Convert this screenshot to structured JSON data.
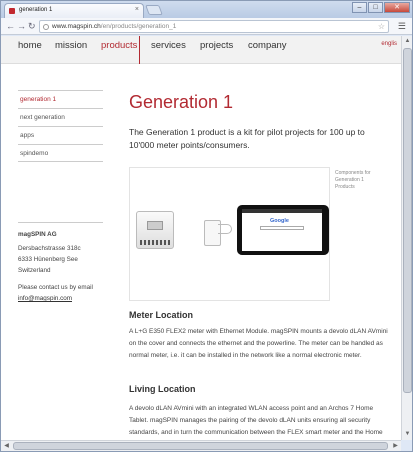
{
  "browser": {
    "tab_title": "generation 1",
    "tab_close": "×",
    "url_domain": "www.magspin.ch",
    "url_path": "/en/products/generation_1",
    "back": "←",
    "forward": "→",
    "reload": "↻",
    "star": "☆",
    "menu": "🔧",
    "minimize": "–",
    "maximize": "□",
    "close": "✕"
  },
  "nav": {
    "items": [
      "home",
      "mission",
      "products",
      "services",
      "projects",
      "company"
    ],
    "active": "products",
    "lang": "englis"
  },
  "sidebar": {
    "items": [
      "generation 1",
      "next generation",
      "apps",
      "spindemo"
    ],
    "active": "generation 1"
  },
  "company": {
    "name": "magSPIN AG",
    "street": "Dersbachstrasse 318c",
    "city": "6333 Hünenberg See",
    "country": "Switzerland",
    "contact_text": "Please contact us by email",
    "email": "info@magspin.com"
  },
  "main": {
    "title": "Generation 1",
    "intro": "The Generation 1 product is a kit for pilot projects for 100 up to 10'000 meter points/consumers.",
    "caption": "Components for Generation 1 Products",
    "tablet_logo": "Google",
    "sections": [
      {
        "heading": "Meter Location",
        "text": "A L+G E350 FLEX2 meter with Ethernet Module. magSPIN mounts a devolo dLAN AVmini on the cover and connects the ethernet and the powerline. The meter can be handled as normal meter, i.e. it can be installed in the network like a normal electronic meter."
      },
      {
        "heading": "Living Location",
        "text": "A devolo dLAN AVmini with an integrated WLAN access point and an Archos 7 Home Tablet. magSPIN manages the pairing of the devolo dLAN units ensuring all security standards, and in turn the communication between the FLEX smart meter and the Home"
      }
    ]
  },
  "colors": {
    "accent": "#b22a32",
    "text": "#333333"
  }
}
